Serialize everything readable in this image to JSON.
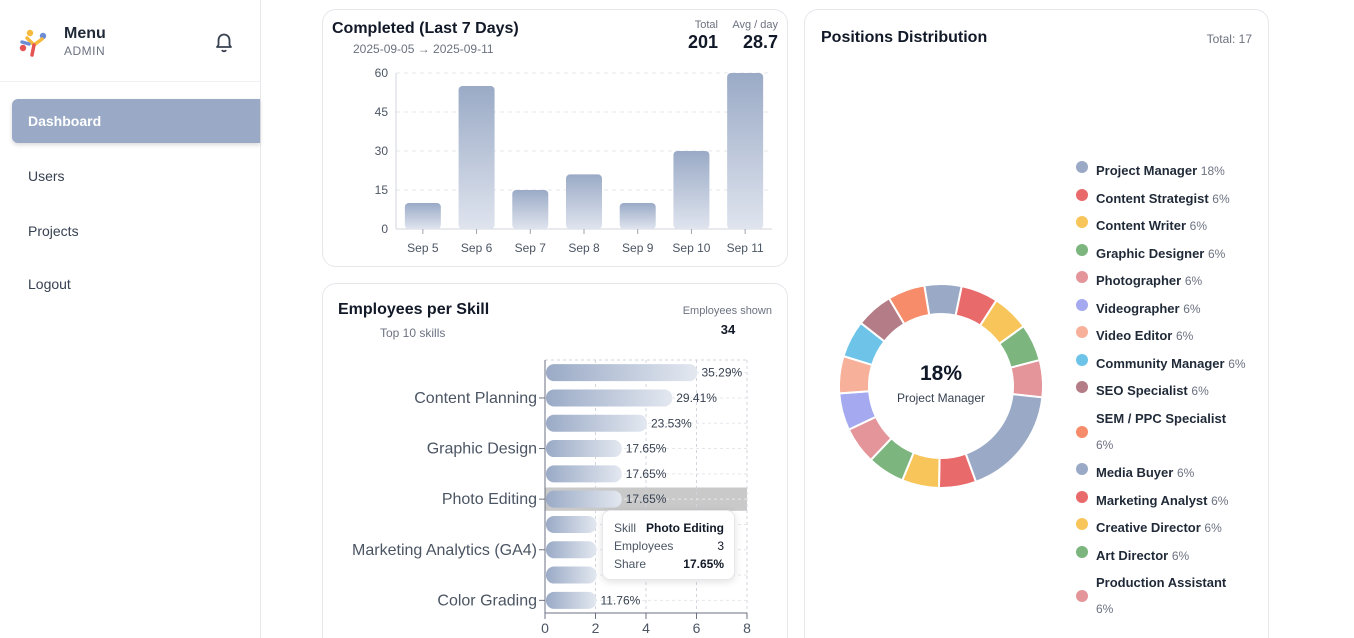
{
  "sidebar": {
    "title": "Menu",
    "role": "ADMIN",
    "items": [
      {
        "label": "Dashboard",
        "active": true
      },
      {
        "label": "Users",
        "active": false
      },
      {
        "label": "Projects",
        "active": false
      },
      {
        "label": "Logout",
        "active": false
      }
    ]
  },
  "completed": {
    "title": "Completed (Last 7 Days)",
    "range": "2025-09-05 → 2025-09-11",
    "total_label": "Total",
    "total_value": "201",
    "avg_label": "Avg / day",
    "avg_value": "28.7"
  },
  "skills": {
    "title": "Employees per Skill",
    "subtitle": "Top 10 skills",
    "shown_label": "Employees shown",
    "shown_value": "34",
    "tooltip": {
      "skill_key": "Skill",
      "skill_val": "Photo Editing",
      "emp_key": "Employees",
      "emp_val": "3",
      "share_key": "Share",
      "share_val": "17.65%"
    }
  },
  "positions": {
    "title": "Positions Distribution",
    "total": "Total: 17",
    "center_pct": "18%",
    "center_label": "Project Manager"
  },
  "colors": {
    "accent": "#9aaac6",
    "bar": "#a3b1ca"
  },
  "chart_data": [
    {
      "type": "bar",
      "title": "Completed (Last 7 Days)",
      "categories": [
        "Sep 5",
        "Sep 6",
        "Sep 7",
        "Sep 8",
        "Sep 9",
        "Sep 10",
        "Sep 11"
      ],
      "values": [
        10,
        55,
        15,
        21,
        10,
        30,
        60
      ],
      "yticks": [
        0,
        15,
        30,
        45,
        60
      ],
      "ylim": [
        0,
        60
      ],
      "grid": true
    },
    {
      "type": "bar",
      "orientation": "horizontal",
      "title": "Employees per Skill",
      "category_labels": [
        "Content Planning",
        "Graphic Design",
        "Photo Editing",
        "Marketing Analytics (GA4)",
        "Color Grading"
      ],
      "values": [
        6,
        5,
        4,
        3,
        3,
        3,
        2,
        2,
        2,
        2
      ],
      "pct_labels": [
        "35.29%",
        "29.41%",
        "23.53%",
        "17.65%",
        "17.65%",
        "17.65%",
        "",
        "",
        "",
        "11.76%"
      ],
      "xticks": [
        0,
        2,
        4,
        6,
        8
      ],
      "xlim": [
        0,
        8
      ],
      "grid": true
    },
    {
      "type": "pie",
      "title": "Positions Distribution",
      "labels": [
        "Project Manager",
        "Content Strategist",
        "Content Writer",
        "Graphic Designer",
        "Photographer",
        "Videographer",
        "Video Editor",
        "Community Manager",
        "SEO Specialist",
        "SEM / PPC Specialist",
        "Media Buyer",
        "Marketing Analyst",
        "Creative Director",
        "Art Director",
        "Production Assistant"
      ],
      "percent_labels": [
        "18%",
        "6%",
        "6%",
        "6%",
        "6%",
        "6%",
        "6%",
        "6%",
        "6%",
        "6%",
        "6%",
        "6%",
        "6%",
        "6%",
        "6%"
      ],
      "counts": [
        3,
        1,
        1,
        1,
        1,
        1,
        1,
        1,
        1,
        1,
        1,
        1,
        1,
        1,
        1
      ],
      "colors": [
        "#9aaac6",
        "#e96a6a",
        "#f8c55b",
        "#7db57f",
        "#e3959a",
        "#a4a9f0",
        "#f7b09a",
        "#6ec4e8",
        "#b47c86",
        "#f68c6a",
        "#9aaac6",
        "#e96a6a",
        "#f8c55b",
        "#7db57f",
        "#e3959a"
      ],
      "donut": true,
      "legend": "right"
    }
  ]
}
